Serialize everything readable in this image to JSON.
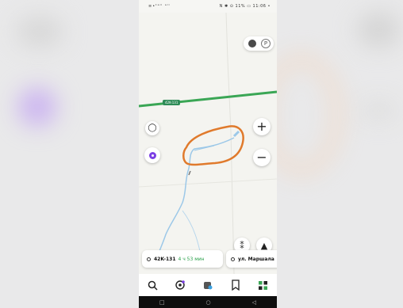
{
  "statusbar": {
    "left": "≡•ᵗᵃˡˡ ᵃˡˡ",
    "right": "N ✱ ⊙ 11% ▭ 11:06 •"
  },
  "map": {
    "road_label": "42K-131"
  },
  "controls": {
    "zoom_in": "+",
    "zoom_out": "−",
    "chat_icon": "chat-bubble-icon",
    "compass": "▲",
    "pin": "⁑"
  },
  "route_cards": [
    {
      "name": "42K-131",
      "time": "4 ч 53 мин"
    },
    {
      "name": "ул. Маршала"
    }
  ],
  "bottom_nav": [
    "search-icon",
    "routes-icon",
    "ride-icon",
    "bookmark-icon",
    "services-icon"
  ],
  "nav_glyphs": {
    "search": "🔍",
    "routes": "◎",
    "ride": "▣",
    "bookmark": "⌑",
    "services": "▦"
  },
  "sysnav": {
    "back": "◁",
    "home": "○",
    "recent": "□"
  },
  "colors": {
    "accent_orange": "#e07a2c",
    "road_green": "#3aa655",
    "alice_purple": "#7b3fe4",
    "river_blue": "#9cc8e8"
  }
}
